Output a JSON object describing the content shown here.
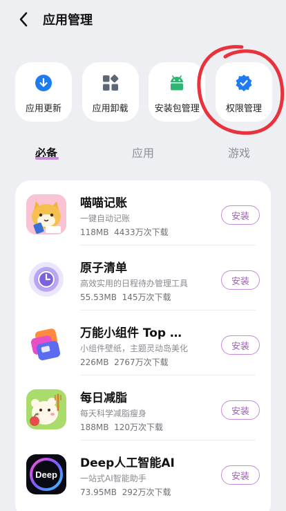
{
  "header": {
    "title": "应用管理"
  },
  "tiles": [
    {
      "label": "应用更新",
      "icon": "download-arrow-icon",
      "color": "#1e7cf0"
    },
    {
      "label": "应用卸载",
      "icon": "grid-squares-icon",
      "color": "#5d6775"
    },
    {
      "label": "安装包管理",
      "icon": "android-icon",
      "color": "#2bb673"
    },
    {
      "label": "权限管理",
      "icon": "verified-shield-icon",
      "color": "#1e7cf0"
    }
  ],
  "tabs": [
    {
      "label": "必备",
      "active": true
    },
    {
      "label": "应用",
      "active": false
    },
    {
      "label": "游戏",
      "active": false
    }
  ],
  "apps": [
    {
      "name": "喵喵记账",
      "desc": "一键自动记账",
      "size": "118MB",
      "downloads": "4433万次下载",
      "button": "安装",
      "icon": "cat-icon"
    },
    {
      "name": "原子清单",
      "desc": "高效实用的日程待办管理工具",
      "size": "55.53MB",
      "downloads": "145万次下载",
      "button": "安装",
      "icon": "clock-icon"
    },
    {
      "name": "万能小组件 Top Widgets",
      "desc": "小组件壁纸，主题灵动岛美化",
      "size": "226MB",
      "downloads": "2767万次下载",
      "button": "安装",
      "icon": "widget-blocks-icon"
    },
    {
      "name": "每日减脂",
      "desc": "每天科学减脂瘦身",
      "size": "188MB",
      "downloads": "120万次下载",
      "button": "安装",
      "icon": "bear-food-icon"
    },
    {
      "name": "Deep人工智能AI",
      "desc": "一站式AI智能助手",
      "size": "73.95MB",
      "downloads": "292万次下载",
      "button": "安装",
      "icon": "deep-logo-icon"
    }
  ],
  "annotation": {
    "color": "#e8323c"
  }
}
